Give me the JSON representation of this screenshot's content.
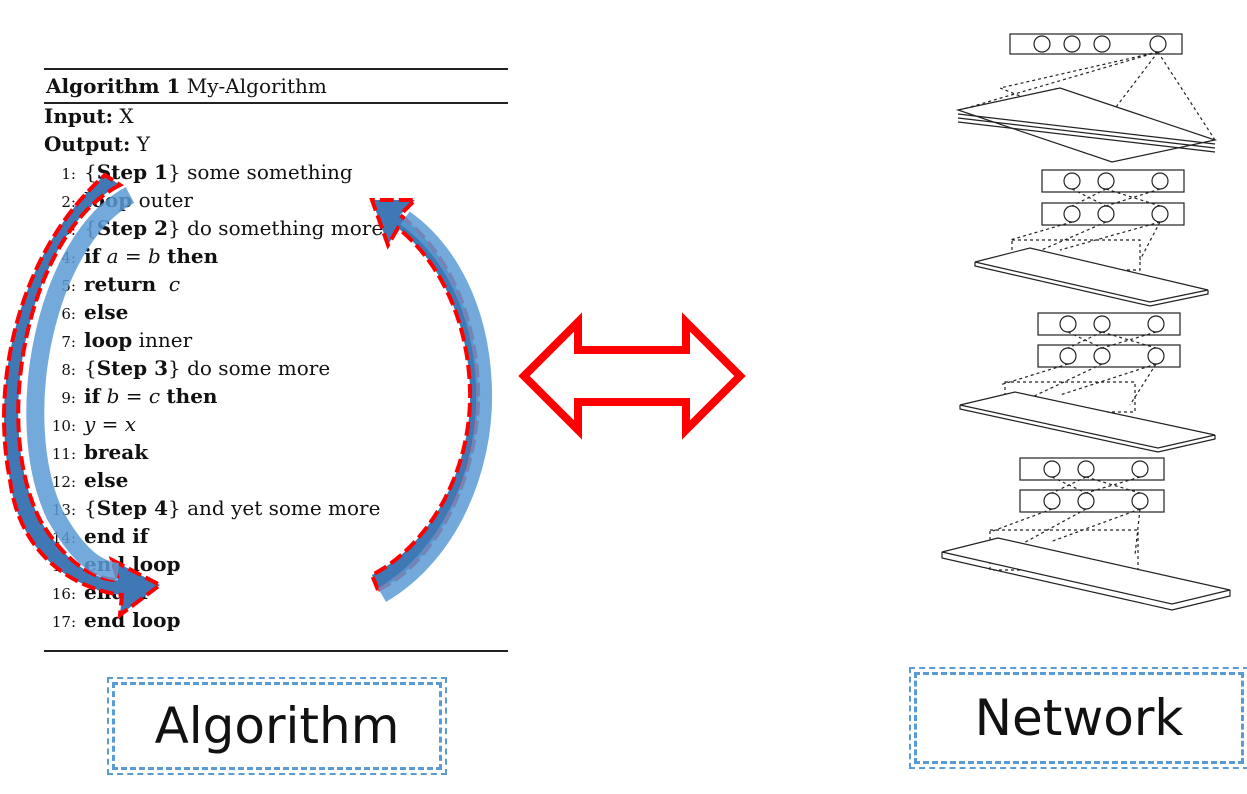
{
  "algorithm": {
    "title_bold": "Algorithm 1",
    "title_name": "My-Algorithm",
    "input_label": "Input:",
    "input_value": "X",
    "output_label": "Output:",
    "output_value": "Y",
    "lines": [
      {
        "n": "1:",
        "text": "{Step 1} some something"
      },
      {
        "n": "2:",
        "text": "loop outer"
      },
      {
        "n": "3:",
        "text": "{Step 2} do something more"
      },
      {
        "n": "4:",
        "text": "if a = b then"
      },
      {
        "n": "5:",
        "text": "return c"
      },
      {
        "n": "6:",
        "text": "else"
      },
      {
        "n": "7:",
        "text": "loop inner"
      },
      {
        "n": "8:",
        "text": "{Step 3} do some more"
      },
      {
        "n": "9:",
        "text": "if b = c then"
      },
      {
        "n": "10:",
        "text": "y = x"
      },
      {
        "n": "11:",
        "text": "break"
      },
      {
        "n": "12:",
        "text": "else"
      },
      {
        "n": "13:",
        "text": "{Step 4} and yet some more"
      },
      {
        "n": "14:",
        "text": "end if"
      },
      {
        "n": "15:",
        "text": "end loop"
      },
      {
        "n": "16:",
        "text": "end if"
      },
      {
        "n": "17:",
        "text": "end loop"
      }
    ]
  },
  "labels": {
    "left": "Algorithm",
    "right": "Network"
  },
  "colors": {
    "arrow_red": "#ff0000",
    "loop_arrow_fill": "#3f78b5",
    "caption_border": "#5b9bd5"
  },
  "icons": {
    "double_arrow": "double-headed-arrow",
    "loop_arrows": "circular-arrows"
  }
}
